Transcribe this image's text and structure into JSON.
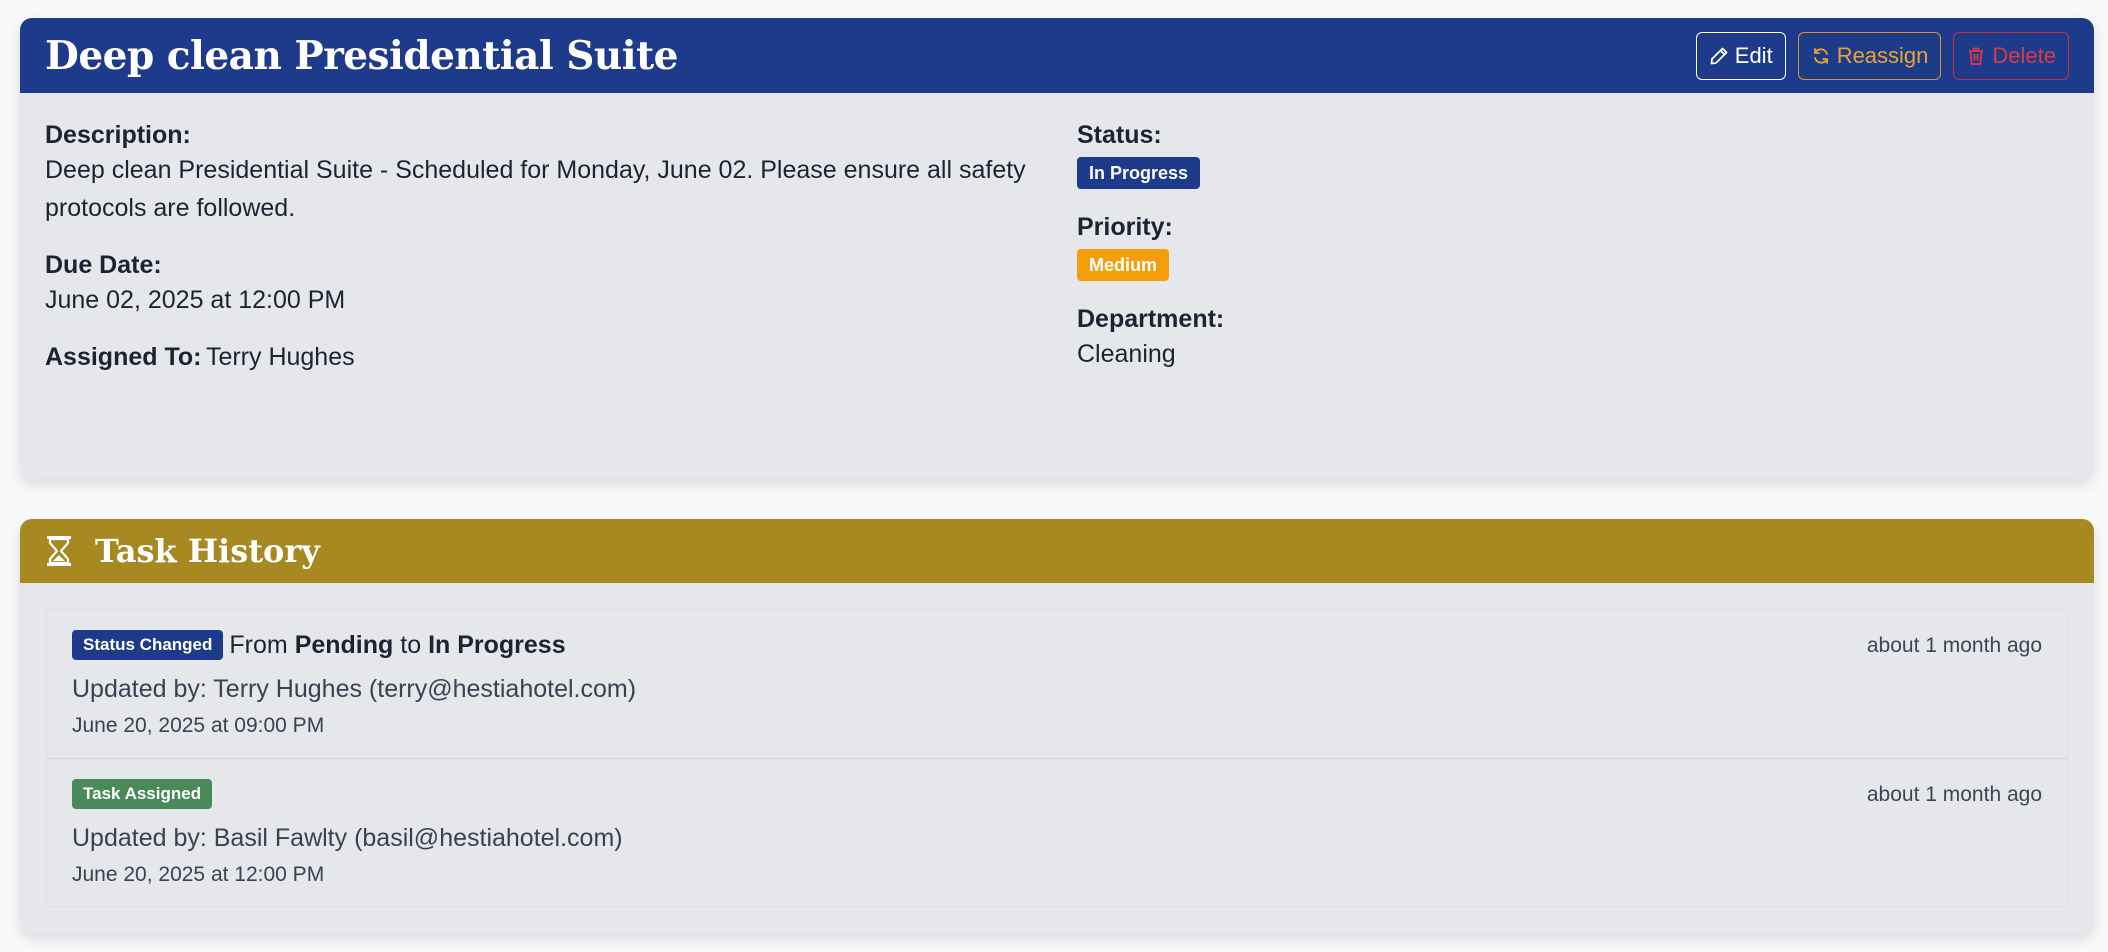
{
  "task": {
    "title": "Deep clean Presidential Suite",
    "actions": {
      "edit_label": "Edit",
      "reassign_label": "Reassign",
      "delete_label": "Delete"
    },
    "description_label": "Description:",
    "description": "Deep clean Presidential Suite - Scheduled for Monday, June 02. Please ensure all safety protocols are followed.",
    "due_date_label": "Due Date:",
    "due_date": "June 02, 2025 at 12:00 PM",
    "assigned_to_label": "Assigned To:",
    "assigned_to": "Terry Hughes",
    "status_label": "Status:",
    "status": "In Progress",
    "priority_label": "Priority:",
    "priority": "Medium",
    "department_label": "Department:",
    "department": "Cleaning"
  },
  "history": {
    "title": "Task History",
    "items": [
      {
        "badge": "Status Changed",
        "from_word": "From",
        "from_value": "Pending",
        "to_word": "to",
        "to_value": "In Progress",
        "time_ago": "about 1 month ago",
        "updated_by": "Updated by: Terry Hughes (terry@hestiahotel.com)",
        "date": "June 20, 2025 at 09:00 PM"
      },
      {
        "badge": "Task Assigned",
        "time_ago": "about 1 month ago",
        "updated_by": "Updated by: Basil Fawlty (basil@hestiahotel.com)",
        "date": "June 20, 2025 at 12:00 PM"
      }
    ]
  },
  "colors": {
    "header_primary": "#1e3a8a",
    "header_history": "#a68920",
    "badge_in_progress": "#1e3a8a",
    "badge_medium": "#f59e0b",
    "badge_task_assigned": "#4a8a5a",
    "reassign_accent": "#e8a431",
    "delete_accent": "#d93a46"
  },
  "icons": {
    "edit": "pencil-icon",
    "reassign": "refresh-icon",
    "delete": "trash-icon",
    "history": "hourglass-icon"
  }
}
